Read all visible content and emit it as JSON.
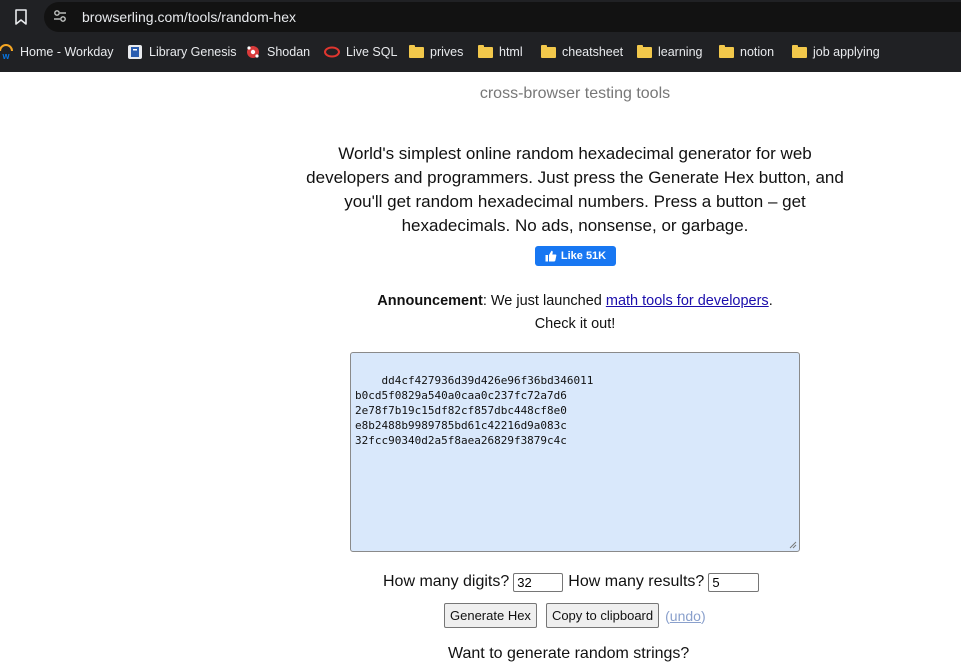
{
  "browser": {
    "url": "browserling.com/tools/random-hex",
    "bookmarks": [
      {
        "label": "Home - Workday",
        "icon": "workday-icon"
      },
      {
        "label": "Library Genesis",
        "icon": "library-genesis-icon"
      },
      {
        "label": "Shodan",
        "icon": "shodan-icon"
      },
      {
        "label": "Live SQL",
        "icon": "oracle-icon"
      },
      {
        "label": "prives",
        "icon": "folder-icon"
      },
      {
        "label": "html",
        "icon": "folder-icon"
      },
      {
        "label": "cheatsheet",
        "icon": "folder-icon"
      },
      {
        "label": "learning",
        "icon": "folder-icon"
      },
      {
        "label": "notion",
        "icon": "folder-icon"
      },
      {
        "label": "job applying",
        "icon": "folder-icon"
      }
    ]
  },
  "page": {
    "tagline": "cross-browser testing tools",
    "intro": "World's simplest online random hexadecimal generator for web developers and programmers. Just press the Generate Hex button, and you'll get random hexadecimal numbers. Press a button – get hexadecimals. No ads, nonsense, or garbage.",
    "like_label": "Like 51K",
    "announcement": {
      "label": "Announcement",
      "text_before": ": We just launched ",
      "link": "math tools for developers",
      "text_after": ".",
      "line2": "Check it out!"
    },
    "output": "dd4cf427936d39d426e96f36bd346011\nb0cd5f0829a540a0caa0c237fc72a7d6\n2e78f7b19c15df82cf857dbc448cf8e0\ne8b2488b9989785bd61c42216d9a083c\n32fcc90340d2a5f8aea26829f3879c4c",
    "digits_label": "How many digits?",
    "digits_value": "32",
    "results_label": "How many results?",
    "results_value": "5",
    "generate_label": "Generate Hex",
    "copy_label": "Copy to clipboard",
    "undo_label": "undo",
    "cutoff_text": "Want to generate random strings?"
  },
  "colors": {
    "chrome_bg": "#202124",
    "textarea_bg": "#d9e8fb",
    "fb_blue": "#1877f2",
    "link": "#1a0dab"
  }
}
